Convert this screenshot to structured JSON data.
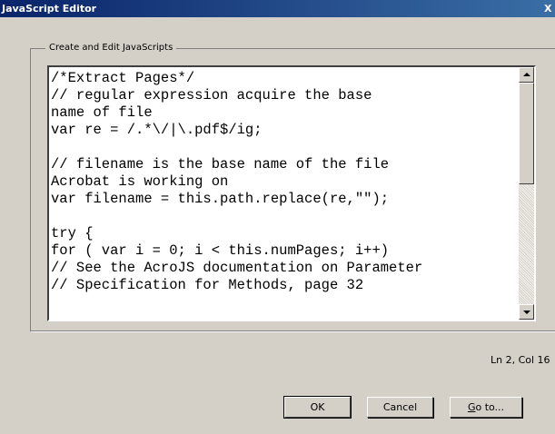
{
  "window": {
    "title": "JavaScript Editor",
    "close_glyph": "X"
  },
  "group": {
    "label": "Create and Edit JavaScripts"
  },
  "editor": {
    "lines": [
      "/*Extract Pages*/",
      "// regular expression acquire the base",
      "name of file",
      "var re = /.*\\/|\\.pdf$/ig;",
      "",
      "// filename is the base name of the file",
      "Acrobat is working on",
      "var filename = this.path.replace(re,\"\");",
      "",
      "try {",
      "for ( var i = 0; i < this.numPages; i++)",
      "// See the AcroJS documentation on Parameter",
      "// Specification for Methods, page 32"
    ]
  },
  "status": {
    "cursor": "Ln 2, Col 16"
  },
  "buttons": {
    "ok": "OK",
    "cancel": "Cancel",
    "goto_mnemonic": "G",
    "goto_rest": "o to..."
  }
}
